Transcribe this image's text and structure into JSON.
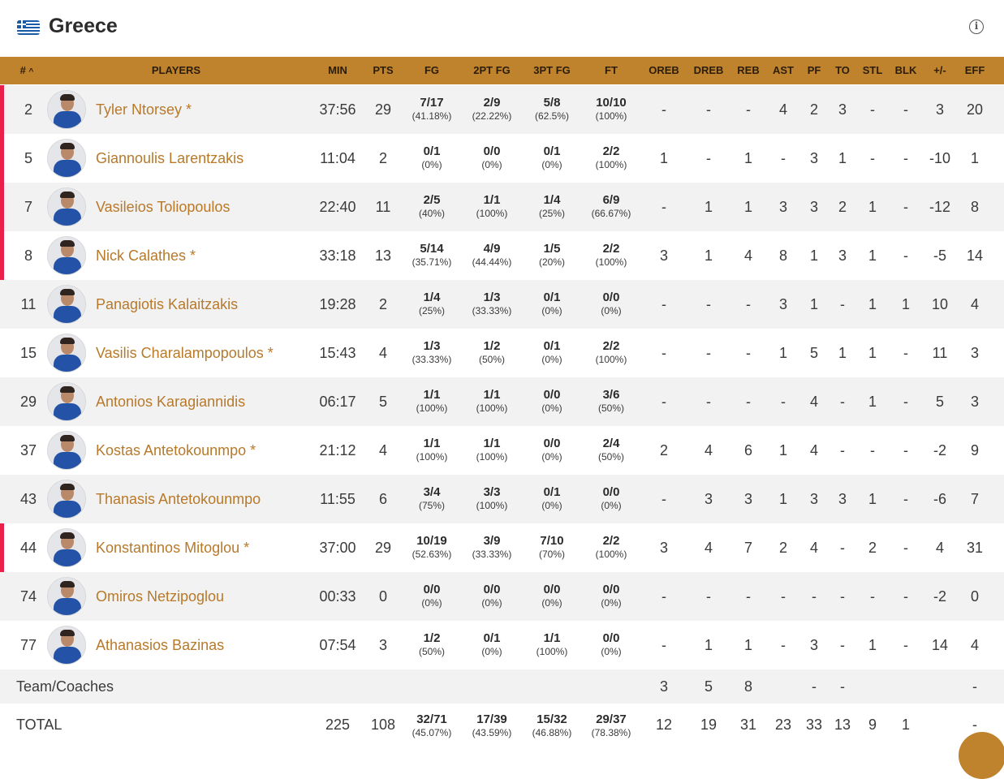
{
  "header": {
    "team": "Greece",
    "flag_icon": "greece-flag-icon",
    "info_icon": "info-icon"
  },
  "columns": {
    "num": "#",
    "sort_indicator": "^",
    "players": "PLAYERS",
    "min": "MIN",
    "pts": "PTS",
    "fg": "FG",
    "fg2": "2PT FG",
    "fg3": "3PT FG",
    "ft": "FT",
    "oreb": "OREB",
    "dreb": "DREB",
    "reb": "REB",
    "ast": "AST",
    "pf": "PF",
    "to": "TO",
    "stl": "STL",
    "blk": "BLK",
    "pm": "+/-",
    "eff": "EFF"
  },
  "accent_color": "#c0832d",
  "starter_color": "#e8204b",
  "players": [
    {
      "num": "2",
      "name": "Tyler Ntorsey *",
      "starter": true,
      "min": "37:56",
      "pts": "29",
      "fg": "7/17",
      "fg_pct": "(41.18%)",
      "fg2": "2/9",
      "fg2_pct": "(22.22%)",
      "fg3": "5/8",
      "fg3_pct": "(62.5%)",
      "ft": "10/10",
      "ft_pct": "(100%)",
      "oreb": "-",
      "dreb": "-",
      "reb": "-",
      "ast": "4",
      "pf": "2",
      "to": "3",
      "stl": "-",
      "blk": "-",
      "pm": "3",
      "eff": "20"
    },
    {
      "num": "5",
      "name": "Giannoulis Larentzakis",
      "starter": true,
      "min": "11:04",
      "pts": "2",
      "fg": "0/1",
      "fg_pct": "(0%)",
      "fg2": "0/0",
      "fg2_pct": "(0%)",
      "fg3": "0/1",
      "fg3_pct": "(0%)",
      "ft": "2/2",
      "ft_pct": "(100%)",
      "oreb": "1",
      "dreb": "-",
      "reb": "1",
      "ast": "-",
      "pf": "3",
      "to": "1",
      "stl": "-",
      "blk": "-",
      "pm": "-10",
      "eff": "1"
    },
    {
      "num": "7",
      "name": "Vasileios Toliopoulos",
      "starter": true,
      "min": "22:40",
      "pts": "11",
      "fg": "2/5",
      "fg_pct": "(40%)",
      "fg2": "1/1",
      "fg2_pct": "(100%)",
      "fg3": "1/4",
      "fg3_pct": "(25%)",
      "ft": "6/9",
      "ft_pct": "(66.67%)",
      "oreb": "-",
      "dreb": "1",
      "reb": "1",
      "ast": "3",
      "pf": "3",
      "to": "2",
      "stl": "1",
      "blk": "-",
      "pm": "-12",
      "eff": "8"
    },
    {
      "num": "8",
      "name": "Nick Calathes *",
      "starter": true,
      "min": "33:18",
      "pts": "13",
      "fg": "5/14",
      "fg_pct": "(35.71%)",
      "fg2": "4/9",
      "fg2_pct": "(44.44%)",
      "fg3": "1/5",
      "fg3_pct": "(20%)",
      "ft": "2/2",
      "ft_pct": "(100%)",
      "oreb": "3",
      "dreb": "1",
      "reb": "4",
      "ast": "8",
      "pf": "1",
      "to": "3",
      "stl": "1",
      "blk": "-",
      "pm": "-5",
      "eff": "14"
    },
    {
      "num": "11",
      "name": "Panagiotis Kalaitzakis",
      "starter": false,
      "min": "19:28",
      "pts": "2",
      "fg": "1/4",
      "fg_pct": "(25%)",
      "fg2": "1/3",
      "fg2_pct": "(33.33%)",
      "fg3": "0/1",
      "fg3_pct": "(0%)",
      "ft": "0/0",
      "ft_pct": "(0%)",
      "oreb": "-",
      "dreb": "-",
      "reb": "-",
      "ast": "3",
      "pf": "1",
      "to": "-",
      "stl": "1",
      "blk": "1",
      "pm": "10",
      "eff": "4"
    },
    {
      "num": "15",
      "name": "Vasilis Charalampopoulos *",
      "starter": false,
      "min": "15:43",
      "pts": "4",
      "fg": "1/3",
      "fg_pct": "(33.33%)",
      "fg2": "1/2",
      "fg2_pct": "(50%)",
      "fg3": "0/1",
      "fg3_pct": "(0%)",
      "ft": "2/2",
      "ft_pct": "(100%)",
      "oreb": "-",
      "dreb": "-",
      "reb": "-",
      "ast": "1",
      "pf": "5",
      "to": "1",
      "stl": "1",
      "blk": "-",
      "pm": "11",
      "eff": "3"
    },
    {
      "num": "29",
      "name": "Antonios Karagiannidis",
      "starter": false,
      "min": "06:17",
      "pts": "5",
      "fg": "1/1",
      "fg_pct": "(100%)",
      "fg2": "1/1",
      "fg2_pct": "(100%)",
      "fg3": "0/0",
      "fg3_pct": "(0%)",
      "ft": "3/6",
      "ft_pct": "(50%)",
      "oreb": "-",
      "dreb": "-",
      "reb": "-",
      "ast": "-",
      "pf": "4",
      "to": "-",
      "stl": "1",
      "blk": "-",
      "pm": "5",
      "eff": "3"
    },
    {
      "num": "37",
      "name": "Kostas Antetokounmpo *",
      "starter": false,
      "min": "21:12",
      "pts": "4",
      "fg": "1/1",
      "fg_pct": "(100%)",
      "fg2": "1/1",
      "fg2_pct": "(100%)",
      "fg3": "0/0",
      "fg3_pct": "(0%)",
      "ft": "2/4",
      "ft_pct": "(50%)",
      "oreb": "2",
      "dreb": "4",
      "reb": "6",
      "ast": "1",
      "pf": "4",
      "to": "-",
      "stl": "-",
      "blk": "-",
      "pm": "-2",
      "eff": "9"
    },
    {
      "num": "43",
      "name": "Thanasis Antetokounmpo",
      "starter": false,
      "min": "11:55",
      "pts": "6",
      "fg": "3/4",
      "fg_pct": "(75%)",
      "fg2": "3/3",
      "fg2_pct": "(100%)",
      "fg3": "0/1",
      "fg3_pct": "(0%)",
      "ft": "0/0",
      "ft_pct": "(0%)",
      "oreb": "-",
      "dreb": "3",
      "reb": "3",
      "ast": "1",
      "pf": "3",
      "to": "3",
      "stl": "1",
      "blk": "-",
      "pm": "-6",
      "eff": "7"
    },
    {
      "num": "44",
      "name": "Konstantinos Mitoglou *",
      "starter": true,
      "min": "37:00",
      "pts": "29",
      "fg": "10/19",
      "fg_pct": "(52.63%)",
      "fg2": "3/9",
      "fg2_pct": "(33.33%)",
      "fg3": "7/10",
      "fg3_pct": "(70%)",
      "ft": "2/2",
      "ft_pct": "(100%)",
      "oreb": "3",
      "dreb": "4",
      "reb": "7",
      "ast": "2",
      "pf": "4",
      "to": "-",
      "stl": "2",
      "blk": "-",
      "pm": "4",
      "eff": "31"
    },
    {
      "num": "74",
      "name": "Omiros Netzipoglou",
      "starter": false,
      "min": "00:33",
      "pts": "0",
      "fg": "0/0",
      "fg_pct": "(0%)",
      "fg2": "0/0",
      "fg2_pct": "(0%)",
      "fg3": "0/0",
      "fg3_pct": "(0%)",
      "ft": "0/0",
      "ft_pct": "(0%)",
      "oreb": "-",
      "dreb": "-",
      "reb": "-",
      "ast": "-",
      "pf": "-",
      "to": "-",
      "stl": "-",
      "blk": "-",
      "pm": "-2",
      "eff": "0"
    },
    {
      "num": "77",
      "name": "Athanasios Bazinas",
      "starter": false,
      "min": "07:54",
      "pts": "3",
      "fg": "1/2",
      "fg_pct": "(50%)",
      "fg2": "0/1",
      "fg2_pct": "(0%)",
      "fg3": "1/1",
      "fg3_pct": "(100%)",
      "ft": "0/0",
      "ft_pct": "(0%)",
      "oreb": "-",
      "dreb": "1",
      "reb": "1",
      "ast": "-",
      "pf": "3",
      "to": "-",
      "stl": "1",
      "blk": "-",
      "pm": "14",
      "eff": "4"
    }
  ],
  "team_coaches": {
    "label": "Team/Coaches",
    "oreb": "3",
    "dreb": "5",
    "reb": "8",
    "pf": "-",
    "to": "-",
    "eff": "-"
  },
  "totals": {
    "label": "TOTAL",
    "min": "225",
    "pts": "108",
    "fg": "32/71",
    "fg_pct": "(45.07%)",
    "fg2": "17/39",
    "fg2_pct": "(43.59%)",
    "fg3": "15/32",
    "fg3_pct": "(46.88%)",
    "ft": "29/37",
    "ft_pct": "(78.38%)",
    "oreb": "12",
    "dreb": "19",
    "reb": "31",
    "ast": "23",
    "pf": "33",
    "to": "13",
    "stl": "9",
    "blk": "1",
    "eff": "-"
  }
}
